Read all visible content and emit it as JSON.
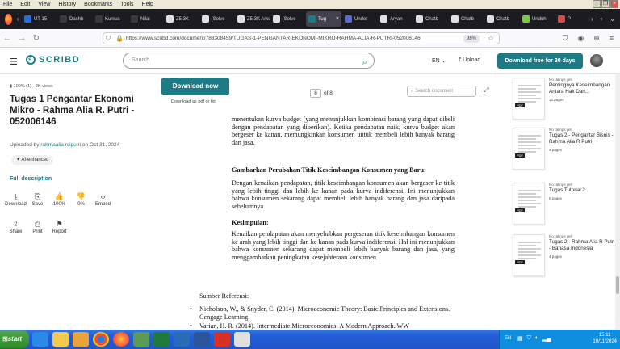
{
  "menubar": {
    "items": [
      "File",
      "Edit",
      "View",
      "History",
      "Bookmarks",
      "Tools",
      "Help"
    ]
  },
  "tabs": [
    {
      "label": "UT 15",
      "color": "#2b6cd6"
    },
    {
      "label": "Dashb",
      "color": "#3a3a3a"
    },
    {
      "label": "Kursus",
      "color": "#3a3a3a"
    },
    {
      "label": "Nilai",
      "color": "#3a3a3a"
    },
    {
      "label": "Z5 3K",
      "color": "#e0e0e0"
    },
    {
      "label": "[Solve",
      "color": "#e0e0e0"
    },
    {
      "label": "Z5 3K Arkus",
      "color": "#e0e0e0"
    },
    {
      "label": "[Solve",
      "color": "#e0e0e0"
    },
    {
      "label": "Tug",
      "color": "#1e7b85",
      "active": true
    },
    {
      "label": "Under",
      "color": "#5a6bd6"
    },
    {
      "label": "Aryan",
      "color": "#e0e0e0"
    },
    {
      "label": "Chatb",
      "color": "#e0e0e0"
    },
    {
      "label": "Chatb",
      "color": "#e0e0e0"
    },
    {
      "label": "Chatb",
      "color": "#e0e0e0"
    },
    {
      "label": "Unduh",
      "color": "#7ac943"
    },
    {
      "label": "P",
      "color": "#d94a4a"
    }
  ],
  "navbar": {
    "url": "https://www.scribd.com/document/788308459/TUGAS-1-PENGANTAR-EKONOMI-MIKRO-RAHMA-ALIA-R-PUTRI-052006146",
    "zoom": "98%"
  },
  "header": {
    "logo": "SCRIBD",
    "search_placeholder": "Search",
    "lang": "EN",
    "upload": "Upload",
    "cta": "Download free for 30 days"
  },
  "left": {
    "meta": "100% (1) · 2K views",
    "title": "Tugas 1 Pengantar Ekonomi Mikro - Rahma Alia R. Putri - 052006146",
    "uploaded_prefix": "Uploaded by",
    "uploaded_user": "rahmaalia rsiputri",
    "uploaded_date": "on Oct 31, 2024",
    "ai_chip": "AI-enhanced",
    "full_description": "Full description",
    "actions": [
      {
        "icon": "download-icon",
        "glyph": "⤓",
        "label": "Download"
      },
      {
        "icon": "save-icon",
        "glyph": "⎘",
        "label": "Save"
      },
      {
        "icon": "like-icon",
        "glyph": "👍",
        "label": "100%"
      },
      {
        "icon": "dislike-icon",
        "glyph": "👎",
        "label": "0%"
      },
      {
        "icon": "embed-icon",
        "glyph": "‹›",
        "label": "Embed"
      }
    ],
    "actions2": [
      {
        "icon": "share-icon",
        "glyph": "⇪",
        "label": "Share"
      },
      {
        "icon": "print-icon",
        "glyph": "⎙",
        "label": "Print"
      },
      {
        "icon": "report-icon",
        "glyph": "⚑",
        "label": "Report"
      }
    ]
  },
  "viewer": {
    "download_now": "Download now",
    "download_pdf": "Download as pdf or txt",
    "page_current": "8",
    "page_total": "of 8",
    "search_placeholder": "Search document",
    "para1": "menentukan kurva budget (yang menunjukkan kombinasi barang yang dapat dibeli dengan pendapatan yang diberikan). Ketika pendapatan naik, kurva budget akan bergeser ke kanan, memungkinkan konsumen untuk membeli lebih banyak barang dan jasa.",
    "heading1": "Gambarkan Perubahan Titik Keseimbangan Konsumen yang Baru:",
    "para2": "Dengan kenaikan pendapatan, titik keseimbangan konsumen akan bergeser ke titik yang lebih tinggi dan lebih ke kanan pada kurva indiferensi. Ini menunjukkan bahwa konsumen sekarang dapat membeli lebih banyak barang dan jasa daripada sebelumnya.",
    "heading2": "Kesimpulan:",
    "para3": "Kenaikan pendapatan akan menyebabkan pergeseran titik keseimbangan konsumen ke arah yang lebih tinggi dan ke kanan pada kurva indiferensi. Hal ini menunjukkan bahwa konsumen sekarang dapat membeli lebih banyak barang dan jasa, yang menggambarkan peningkatan kesejahteraan konsumen.",
    "refs_heading": "Sumber Referensi:",
    "refs": [
      "Nicholson, W., & Snyder, C. (2014). Microeconomic Theory: Basic Principles and Extensions. Cengage Learning.",
      "Varian, H. R. (2014). Intermediate Microeconomics: A Modern Approach. WW"
    ]
  },
  "related": [
    {
      "rating": "No ratings yet",
      "title": "Pentingnya Keseimbangan Antara Hak Dan...",
      "pages": "13 pages"
    },
    {
      "rating": "No ratings yet",
      "title": "Tugas 2 - Pengantar Bisnis - Rahma Alia R Putri",
      "pages": "4 pages"
    },
    {
      "rating": "No ratings yet",
      "title": "Tugas Tutorial 2",
      "pages": "5 pages"
    },
    {
      "rating": "No ratings yet",
      "title": "Tugas 2 - Rahma Alia R Putri - Bahasa Indonesia",
      "pages": "4 pages"
    }
  ],
  "taskbar": {
    "start": "start",
    "tray_lang": "EN",
    "time": "15:11",
    "date": "10/11/2024"
  }
}
